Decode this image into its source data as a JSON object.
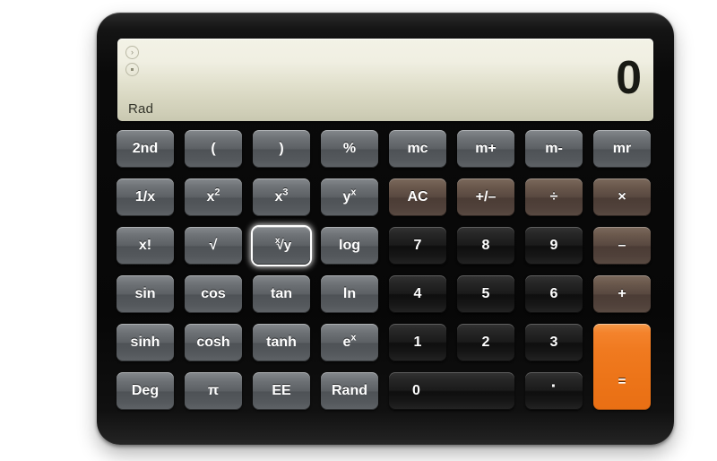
{
  "app": {
    "title": "Calculator",
    "mode_label": "Rad"
  },
  "display": {
    "value": "0",
    "mode": "Rad",
    "indicator_top": "chevron-right-icon",
    "indicator_bottom": "dot-icon",
    "background_color": "#e9e8d8",
    "text_color": "#191a14"
  },
  "colors": {
    "body": "#0a0a0a",
    "gray_key": "#5c6064",
    "brown_key": "#584840",
    "black_key": "#1b1b1b",
    "orange_key": "#f07a20",
    "key_text": "#ffffff",
    "focus_ring": "#ffffff"
  },
  "keys": [
    {
      "id": "2nd",
      "label": "2nd",
      "style": "gray",
      "row": 1,
      "col": 1
    },
    {
      "id": "lparen",
      "label": "(",
      "style": "gray",
      "row": 1,
      "col": 2
    },
    {
      "id": "rparen",
      "label": ")",
      "style": "gray",
      "row": 1,
      "col": 3
    },
    {
      "id": "pct",
      "label": "%",
      "style": "gray",
      "row": 1,
      "col": 4
    },
    {
      "id": "mc",
      "label": "mc",
      "style": "gray",
      "row": 1,
      "col": 5
    },
    {
      "id": "mplus",
      "label": "m+",
      "style": "gray",
      "row": 1,
      "col": 6
    },
    {
      "id": "mminus",
      "label": "m-",
      "style": "gray",
      "row": 1,
      "col": 7
    },
    {
      "id": "mr",
      "label": "mr",
      "style": "gray",
      "row": 1,
      "col": 8
    },
    {
      "id": "inv",
      "label": "1/x",
      "style": "gray",
      "row": 2,
      "col": 1
    },
    {
      "id": "sq",
      "label": "x2",
      "style": "gray",
      "row": 2,
      "col": 2
    },
    {
      "id": "cube",
      "label": "x3",
      "style": "gray",
      "row": 2,
      "col": 3
    },
    {
      "id": "ypow",
      "label": "yx",
      "style": "gray",
      "row": 2,
      "col": 4
    },
    {
      "id": "ac",
      "label": "AC",
      "style": "brown",
      "row": 2,
      "col": 5
    },
    {
      "id": "negate",
      "label": "+/–",
      "style": "brown",
      "row": 2,
      "col": 6
    },
    {
      "id": "divide",
      "label": "÷",
      "style": "brown",
      "row": 2,
      "col": 7
    },
    {
      "id": "times",
      "label": "×",
      "style": "brown",
      "row": 2,
      "col": 8
    },
    {
      "id": "fact",
      "label": "x!",
      "style": "gray",
      "row": 3,
      "col": 1
    },
    {
      "id": "sqrt",
      "label": "√",
      "style": "gray",
      "row": 3,
      "col": 2
    },
    {
      "id": "xrooty",
      "label": "x√y",
      "style": "gray",
      "row": 3,
      "col": 3,
      "focused": true
    },
    {
      "id": "log",
      "label": "log",
      "style": "gray",
      "row": 3,
      "col": 4
    },
    {
      "id": "n7",
      "label": "7",
      "style": "black",
      "row": 3,
      "col": 5
    },
    {
      "id": "n8",
      "label": "8",
      "style": "black",
      "row": 3,
      "col": 6
    },
    {
      "id": "n9",
      "label": "9",
      "style": "black",
      "row": 3,
      "col": 7
    },
    {
      "id": "minus",
      "label": "–",
      "style": "brown",
      "row": 3,
      "col": 8
    },
    {
      "id": "sin",
      "label": "sin",
      "style": "gray",
      "row": 4,
      "col": 1
    },
    {
      "id": "cos",
      "label": "cos",
      "style": "gray",
      "row": 4,
      "col": 2
    },
    {
      "id": "tan",
      "label": "tan",
      "style": "gray",
      "row": 4,
      "col": 3
    },
    {
      "id": "ln",
      "label": "ln",
      "style": "gray",
      "row": 4,
      "col": 4
    },
    {
      "id": "n4",
      "label": "4",
      "style": "black",
      "row": 4,
      "col": 5
    },
    {
      "id": "n5",
      "label": "5",
      "style": "black",
      "row": 4,
      "col": 6
    },
    {
      "id": "n6",
      "label": "6",
      "style": "black",
      "row": 4,
      "col": 7
    },
    {
      "id": "plus",
      "label": "+",
      "style": "brown",
      "row": 4,
      "col": 8
    },
    {
      "id": "sinh",
      "label": "sinh",
      "style": "gray",
      "row": 5,
      "col": 1
    },
    {
      "id": "cosh",
      "label": "cosh",
      "style": "gray",
      "row": 5,
      "col": 2
    },
    {
      "id": "tanh",
      "label": "tanh",
      "style": "gray",
      "row": 5,
      "col": 3
    },
    {
      "id": "exp",
      "label": "ex",
      "style": "gray",
      "row": 5,
      "col": 4
    },
    {
      "id": "n1",
      "label": "1",
      "style": "black",
      "row": 5,
      "col": 5
    },
    {
      "id": "n2",
      "label": "2",
      "style": "black",
      "row": 5,
      "col": 6
    },
    {
      "id": "n3",
      "label": "3",
      "style": "black",
      "row": 5,
      "col": 7
    },
    {
      "id": "equals",
      "label": "=",
      "style": "orange",
      "row": 5,
      "col": 8,
      "rowspan": 2
    },
    {
      "id": "deg",
      "label": "Deg",
      "style": "gray",
      "row": 6,
      "col": 1
    },
    {
      "id": "pi",
      "label": "π",
      "style": "gray",
      "row": 6,
      "col": 2
    },
    {
      "id": "ee",
      "label": "EE",
      "style": "gray",
      "row": 6,
      "col": 3
    },
    {
      "id": "rand",
      "label": "Rand",
      "style": "gray",
      "row": 6,
      "col": 4
    },
    {
      "id": "n0",
      "label": "0",
      "style": "black",
      "row": 6,
      "col": 5,
      "colspan": 2
    },
    {
      "id": "dot",
      "label": ".",
      "style": "black",
      "row": 6,
      "col": 7
    }
  ]
}
